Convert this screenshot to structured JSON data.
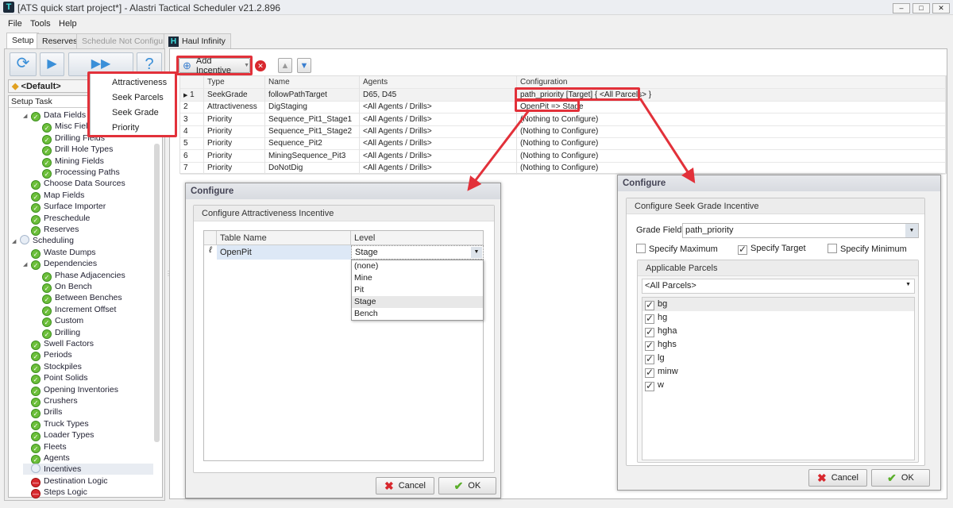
{
  "window": {
    "title": "[ATS quick start project*] - Alastri Tactical Scheduler v21.2.896",
    "logo": "T",
    "minimize": "–",
    "maximize": "□",
    "close": "✕"
  },
  "menu": [
    "File",
    "Tools",
    "Help"
  ],
  "tabs": [
    {
      "label": "Setup",
      "state": "active"
    },
    {
      "label": "Reserves",
      "state": "normal"
    },
    {
      "label": "Schedule Not Configured",
      "state": "disabled"
    },
    {
      "label": "Haul Infinity",
      "state": "normal"
    }
  ],
  "left": {
    "profile": "<Default>",
    "tree_header": "Setup Task",
    "tree": [
      {
        "label": "Data Fields",
        "level": 1,
        "status": "ok",
        "expander": "◢"
      },
      {
        "label": "Misc Fields",
        "level": 2,
        "status": "ok"
      },
      {
        "label": "Drilling Fields",
        "level": 2,
        "status": "ok"
      },
      {
        "label": "Drill Hole Types",
        "level": 2,
        "status": "ok"
      },
      {
        "label": "Mining Fields",
        "level": 2,
        "status": "ok"
      },
      {
        "label": "Processing Paths",
        "level": 2,
        "status": "ok"
      },
      {
        "label": "Choose Data Sources",
        "level": 1,
        "status": "ok"
      },
      {
        "label": "Map Fields",
        "level": 1,
        "status": "ok"
      },
      {
        "label": "Surface Importer",
        "level": 1,
        "status": "ok"
      },
      {
        "label": "Preschedule",
        "level": 1,
        "status": "ok"
      },
      {
        "label": "Reserves",
        "level": 1,
        "status": "ok"
      },
      {
        "label": "Scheduling",
        "level": 0,
        "status": "pending",
        "expander": "◢"
      },
      {
        "label": "Waste Dumps",
        "level": 1,
        "status": "ok"
      },
      {
        "label": "Dependencies",
        "level": 1,
        "status": "ok",
        "expander": "◢"
      },
      {
        "label": "Phase Adjacencies",
        "level": 2,
        "status": "ok"
      },
      {
        "label": "On Bench",
        "level": 2,
        "status": "ok"
      },
      {
        "label": "Between Benches",
        "level": 2,
        "status": "ok"
      },
      {
        "label": "Increment Offset",
        "level": 2,
        "status": "ok"
      },
      {
        "label": "Custom",
        "level": 2,
        "status": "ok"
      },
      {
        "label": "Drilling",
        "level": 2,
        "status": "ok"
      },
      {
        "label": "Swell Factors",
        "level": 1,
        "status": "ok"
      },
      {
        "label": "Periods",
        "level": 1,
        "status": "ok"
      },
      {
        "label": "Stockpiles",
        "level": 1,
        "status": "ok"
      },
      {
        "label": "Point Solids",
        "level": 1,
        "status": "ok"
      },
      {
        "label": "Opening Inventories",
        "level": 1,
        "status": "ok"
      },
      {
        "label": "Crushers",
        "level": 1,
        "status": "ok"
      },
      {
        "label": "Drills",
        "level": 1,
        "status": "ok"
      },
      {
        "label": "Truck Types",
        "level": 1,
        "status": "ok"
      },
      {
        "label": "Loader Types",
        "level": 1,
        "status": "ok"
      },
      {
        "label": "Fleets",
        "level": 1,
        "status": "ok"
      },
      {
        "label": "Agents",
        "level": 1,
        "status": "ok"
      },
      {
        "label": "Incentives",
        "level": 1,
        "status": "pending",
        "selected": true
      },
      {
        "label": "Destination Logic",
        "level": 1,
        "status": "error"
      },
      {
        "label": "Steps Logic",
        "level": 1,
        "status": "error"
      }
    ]
  },
  "toolbar": {
    "add_incentive": "Add Incentive",
    "add_menu": [
      "Attractiveness",
      "Seek Parcels",
      "Seek Grade",
      "Priority"
    ]
  },
  "grid": {
    "columns": [
      "Type",
      "Name",
      "Agents",
      "Configuration"
    ],
    "rows": [
      {
        "n": "1",
        "type": "SeekGrade",
        "name": "followPathTarget",
        "agents": "D65, D45",
        "config": "path_priority [Target] { <All Parcels> }",
        "current": true
      },
      {
        "n": "2",
        "type": "Attractiveness",
        "name": "DigStaging",
        "agents": "<All Agents / Drills>",
        "config": "OpenPit => Stage"
      },
      {
        "n": "3",
        "type": "Priority",
        "name": "Sequence_Pit1_Stage1",
        "agents": "<All Agents / Drills>",
        "config": "(Nothing to Configure)"
      },
      {
        "n": "4",
        "type": "Priority",
        "name": "Sequence_Pit1_Stage2",
        "agents": "<All Agents / Drills>",
        "config": "(Nothing to Configure)"
      },
      {
        "n": "5",
        "type": "Priority",
        "name": "Sequence_Pit2",
        "agents": "<All Agents / Drills>",
        "config": "(Nothing to Configure)"
      },
      {
        "n": "6",
        "type": "Priority",
        "name": "MiningSequence_Pit3",
        "agents": "<All Agents / Drills>",
        "config": "(Nothing to Configure)"
      },
      {
        "n": "7",
        "type": "Priority",
        "name": "DoNotDig",
        "agents": "<All Agents / Drills>",
        "config": "(Nothing to Configure)"
      }
    ]
  },
  "dlg1": {
    "title": "Configure",
    "group": "Configure Attractiveness Incentive",
    "col_table": "Table Name",
    "col_level": "Level",
    "row_table": "OpenPit",
    "row_level": "Stage",
    "options": [
      "(none)",
      "Mine",
      "Pit",
      "Stage",
      "Bench"
    ],
    "highlighted": "Stage",
    "cancel": "Cancel",
    "ok": "OK"
  },
  "dlg2": {
    "title": "Configure",
    "group": "Configure Seek Grade Incentive",
    "grade_label": "Grade Field",
    "grade_value": "path_priority",
    "checks": [
      {
        "label": "Specify Maximum",
        "checked": false
      },
      {
        "label": "Specify Target",
        "checked": true
      },
      {
        "label": "Specify Minimum",
        "checked": false
      }
    ],
    "parcels_header": "Applicable Parcels",
    "parcels_filter": "<All Parcels>",
    "parcels": [
      {
        "label": "bg",
        "checked": true
      },
      {
        "label": "hg",
        "checked": true
      },
      {
        "label": "hgha",
        "checked": true
      },
      {
        "label": "hghs",
        "checked": true
      },
      {
        "label": "lg",
        "checked": true
      },
      {
        "label": "minw",
        "checked": true
      },
      {
        "label": "w",
        "checked": true
      }
    ],
    "cancel": "Cancel",
    "ok": "OK"
  },
  "colors": {
    "highlight": "#e2313a",
    "ok": "#6cbf3a",
    "error": "#d8282e",
    "selection": "#dde8f6"
  }
}
